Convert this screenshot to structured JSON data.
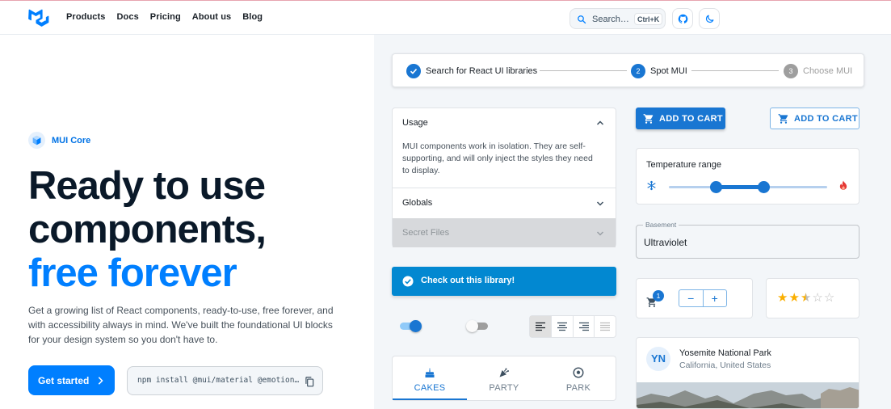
{
  "nav": {
    "items": [
      "Products",
      "Docs",
      "Pricing",
      "About us",
      "Blog"
    ],
    "search_label": "Search…",
    "search_shortcut": "Ctrl+K"
  },
  "hero": {
    "badge": "MUI Core",
    "title_line1": "Ready to use",
    "title_line2": "components,",
    "title_line3": "free forever",
    "description": "Get a growing list of React components, ready-to-use, free forever, and with accessibility always in mind. We've built the foundational UI blocks for your design system so you don't have to.",
    "cta_label": "Get started",
    "install_command": "npm install @mui/material @emotion…"
  },
  "demo": {
    "stepper": {
      "steps": [
        "Search for React UI libraries",
        "Spot MUI",
        "Choose MUI"
      ],
      "step_numbers": [
        "2",
        "3"
      ],
      "active_step": 1
    },
    "accordion": {
      "items": [
        "Usage",
        "Globals",
        "Secret Files"
      ],
      "usage_body": "MUI components work in isolation. They are self-supporting, and will only inject the styles they need to display."
    },
    "alert": "Check out this library!",
    "switches": [
      true,
      false
    ],
    "text_align_selected": "left",
    "tabs": [
      "CAKES",
      "PARTY",
      "PARK"
    ],
    "active_tab": "CAKES",
    "buttons": {
      "contained": "ADD TO CART",
      "outlined": "ADD TO CART"
    },
    "slider": {
      "label": "Temperature range",
      "min": 0,
      "max": 100,
      "value": [
        30,
        60
      ]
    },
    "text_field": {
      "label": "Basement",
      "value": "Ultraviolet"
    },
    "cart_badge_count": "1",
    "stepper_controls": [
      "−",
      "+"
    ],
    "rating": {
      "value": 2.5,
      "max": 5
    },
    "card": {
      "avatar": "YN",
      "title": "Yosemite National Park",
      "subtitle": "California, United States"
    }
  },
  "colors": {
    "primary": "#007fff",
    "dark": "#0a1929",
    "mui_blue": "#1976d2",
    "info": "#0288d1",
    "star": "#faaf00"
  }
}
